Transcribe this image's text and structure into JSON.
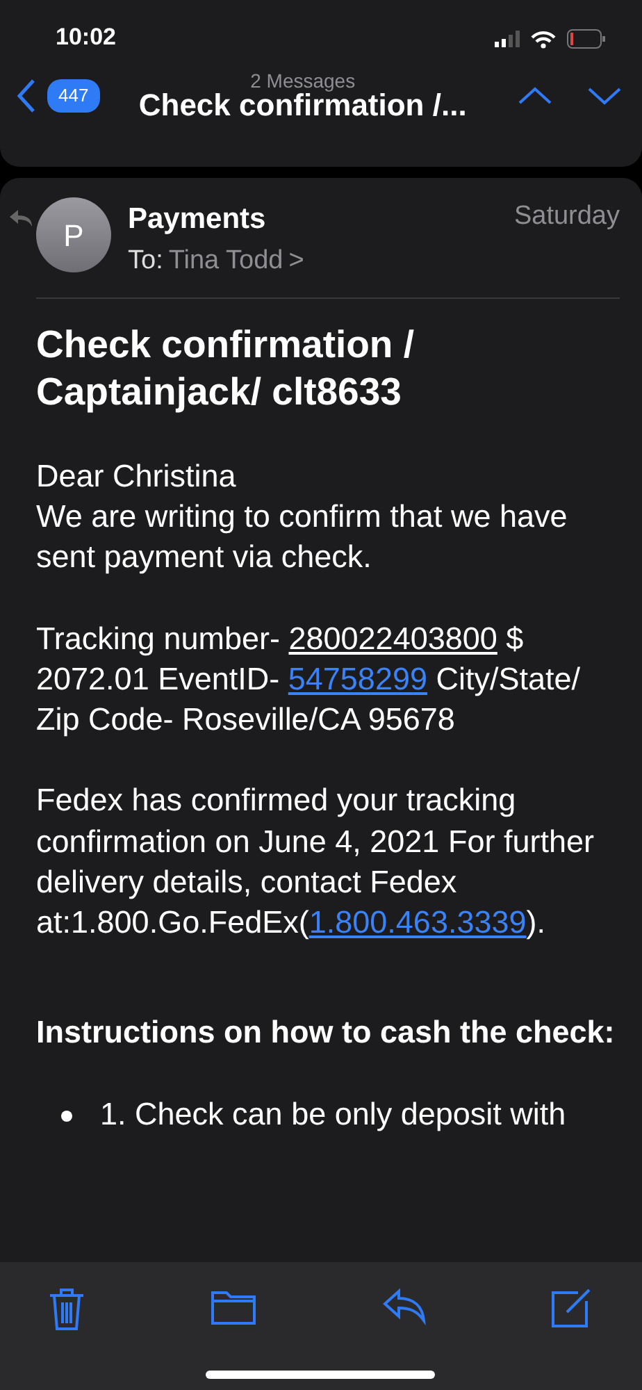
{
  "status_bar": {
    "time": "10:02"
  },
  "nav": {
    "back_count": "447",
    "thread_count": "2 Messages",
    "title": "Check confirmation /..."
  },
  "message": {
    "avatar_initial": "P",
    "sender": "Payments",
    "to_label": "To:",
    "recipient": "Tina Todd",
    "chevron": ">",
    "date": "Saturday",
    "subject": "Check confirmation / Captainjack/ clt8633",
    "paragraphs": [
      {
        "kind": "text",
        "parts": [
          {
            "text": "Dear Christina"
          }
        ]
      },
      {
        "kind": "text",
        "parts": [
          {
            "text": "We are writing to confirm that we have sent payment via check."
          }
        ]
      },
      {
        "kind": "text",
        "parts": [
          {
            "text": "Tracking number- "
          },
          {
            "text": "280022403800",
            "kind": "underline"
          },
          {
            "text": " $ 2072.01 EventID- "
          },
          {
            "text": "54758299",
            "kind": "link"
          },
          {
            "text": " City/State/ Zip Code- Roseville/CA 95678"
          }
        ]
      },
      {
        "kind": "text",
        "parts": [
          {
            "text": "Fedex has confirmed your tracking confirmation on June 4, 2021 For further delivery details, contact Fedex at:1.800.Go.FedEx("
          },
          {
            "text": "1.800.463.3339",
            "kind": "link"
          },
          {
            "text": ")."
          }
        ]
      },
      {
        "kind": "heading",
        "parts": [
          {
            "text": "Instructions on how to cash the check:"
          }
        ]
      },
      {
        "kind": "bullet",
        "parts": [
          {
            "text": "1. Check can be only deposit with"
          }
        ]
      }
    ]
  }
}
